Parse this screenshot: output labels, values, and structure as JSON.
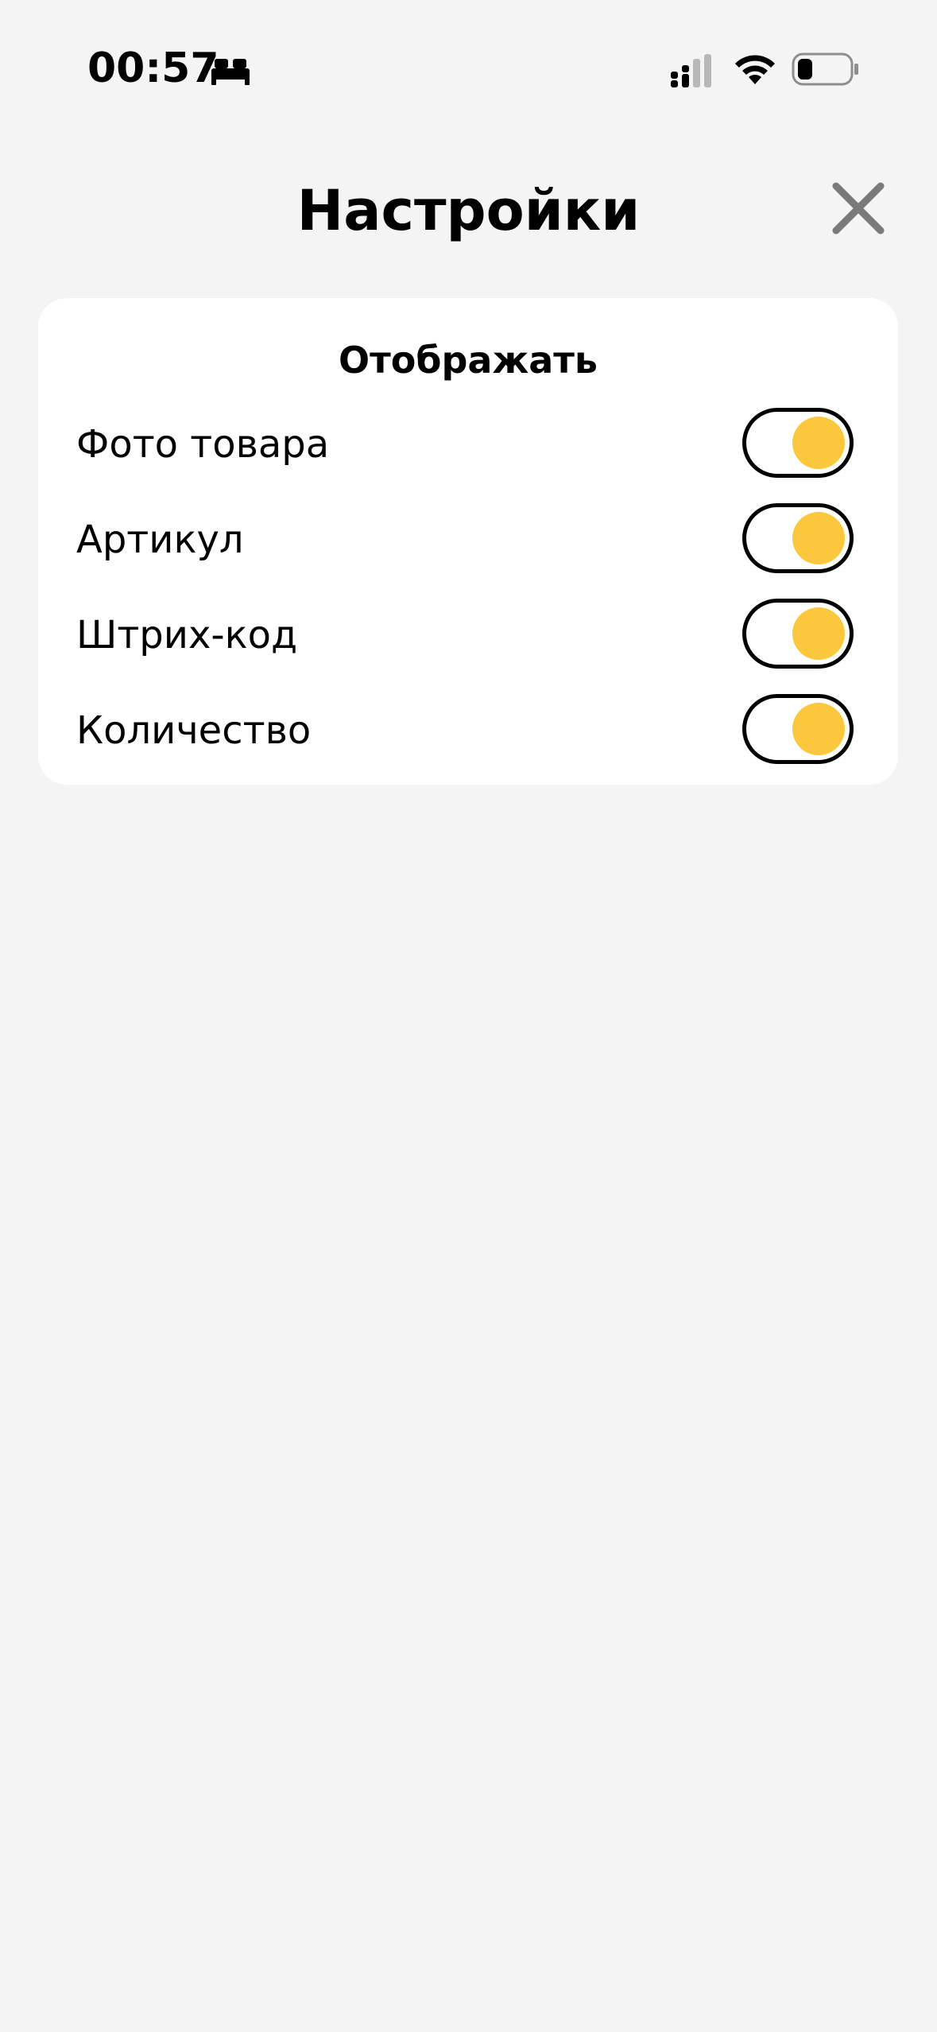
{
  "status_bar": {
    "time": "00:57",
    "icons": [
      "bed-icon",
      "cellular-signal-icon",
      "wifi-icon",
      "battery-icon"
    ]
  },
  "header": {
    "title": "Настройки",
    "close_icon": "close-icon"
  },
  "display_section": {
    "title": "Отображать",
    "items": [
      {
        "label": "Фото товара",
        "enabled": true
      },
      {
        "label": "Артикул",
        "enabled": true
      },
      {
        "label": "Штрих-код",
        "enabled": true
      },
      {
        "label": "Количество",
        "enabled": true
      }
    ]
  },
  "colors": {
    "background": "#f4f4f4",
    "card": "#ffffff",
    "toggle_knob": "#fac73d",
    "close_icon": "#7a7a7a"
  }
}
